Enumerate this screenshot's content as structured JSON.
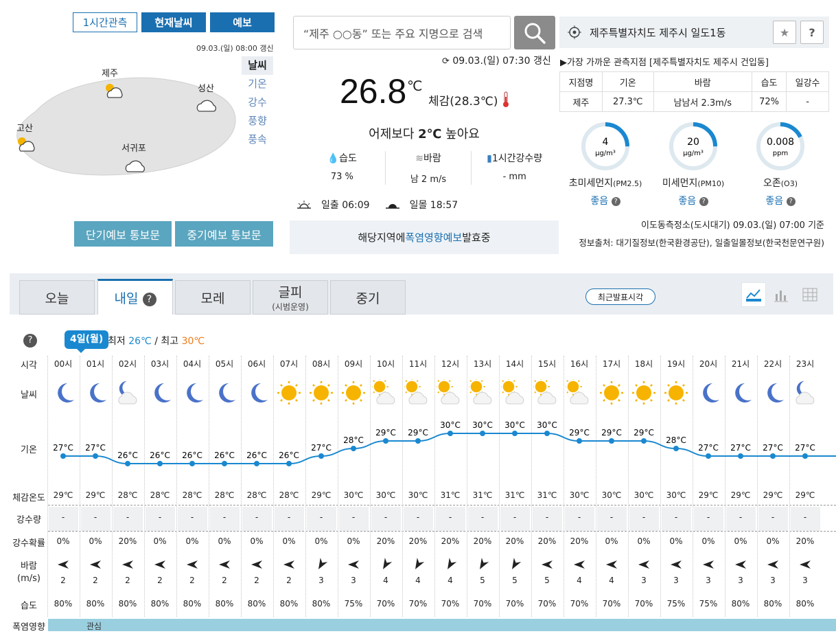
{
  "map": {
    "tabs": [
      "1시간관측",
      "현재날씨",
      "예보"
    ],
    "update_time": "09.03.(일) 08:00 갱신",
    "layers": [
      "날씨",
      "기온",
      "강수",
      "풍향",
      "풍속"
    ],
    "cities": {
      "jeju": "제주",
      "seongsan": "성산",
      "gosan": "고산",
      "seogwipo": "서귀포"
    },
    "buttons": {
      "short_term": "단기예보 통보문",
      "mid_term": "중기예보 통보문"
    }
  },
  "search": {
    "placeholder": "“제주 ○○동” 또는 주요 지명으로 검색"
  },
  "current": {
    "update_time": "09.03.(일) 07:30 갱신",
    "temp": "26.8",
    "unit": "℃",
    "feels": "체감(28.3℃)",
    "compare_pre": "어제보다 ",
    "compare_val": "2℃",
    "compare_post": " 높아요",
    "humidity_label": "습도",
    "humidity_value": "73 %",
    "wind_label": "바람",
    "wind_value": "남 2 m/s",
    "rain_label": "1시간강수량",
    "rain_value": "- mm",
    "sunrise_label": "일출",
    "sunrise": "06:09",
    "sunset_label": "일몰",
    "sunset": "18:57",
    "heat_notice_pre": "해당지역에 ",
    "heat_notice_link": "폭염영향예보",
    "heat_notice_post": " 발효중"
  },
  "location": {
    "name": "제주특별자치도 제주시 일도1동",
    "star_icon": "★",
    "help": "?",
    "nearest": "▶가장 가까운 관측지점 [제주특별자치도 제주시 건입동]",
    "table_headers": [
      "지점명",
      "기온",
      "바람",
      "습도",
      "일강수"
    ],
    "table_row": [
      "제주",
      "27.3℃",
      "남남서 2.3m/s",
      "72%",
      "-"
    ]
  },
  "air": {
    "items": [
      {
        "value": "4",
        "unit": "μg/m³",
        "label": "초미세먼지",
        "sub": "(PM2.5)",
        "grade": "좋음",
        "fraction": 0.25
      },
      {
        "value": "20",
        "unit": "μg/m³",
        "label": "미세먼지",
        "sub": "(PM10)",
        "grade": "좋음",
        "fraction": 0.25
      },
      {
        "value": "0.008",
        "unit": "ppm",
        "label": "오존",
        "sub": "(O3)",
        "grade": "좋음",
        "fraction": 0.18
      }
    ],
    "station": "이도동측정소(도시대기) 09.03.(일) 07:00 기준",
    "source": "정보출처: 대기질정보(한국환경공단), 일출일몰정보(한국천문연구원)"
  },
  "forecast": {
    "tabs": [
      {
        "label": "오늘",
        "sub": ""
      },
      {
        "label": "내일",
        "sub": ""
      },
      {
        "label": "모레",
        "sub": ""
      },
      {
        "label": "글피",
        "sub": "(시범운영)"
      },
      {
        "label": "중기",
        "sub": ""
      }
    ],
    "recent_button": "최근발표시각",
    "day_pill": "4일(월)",
    "min_label": "최저",
    "min_value": "26℃",
    "max_label": "최고",
    "max_value": "30℃",
    "row_labels": {
      "time": "시각",
      "weather": "날씨",
      "temp": "기온",
      "feels": "체감온도",
      "rain": "강수량",
      "rain_prob": "강수확률",
      "wind": "바람",
      "wind_unit": "(m/s)",
      "humidity": "습도",
      "heat": "폭염영향"
    },
    "heat_level": "관심",
    "hours": [
      "00시",
      "01시",
      "02시",
      "03시",
      "04시",
      "05시",
      "06시",
      "07시",
      "08시",
      "09시",
      "10시",
      "11시",
      "12시",
      "13시",
      "14시",
      "15시",
      "16시",
      "17시",
      "18시",
      "19시",
      "20시",
      "21시",
      "22시",
      "23시"
    ],
    "weather_icons": [
      "moon",
      "moon",
      "moon-cloud",
      "moon",
      "moon",
      "moon",
      "moon",
      "sun",
      "sun",
      "sun",
      "sun-cloud",
      "sun-cloud",
      "sun-cloud",
      "sun-cloud",
      "sun-cloud",
      "sun-cloud",
      "sun-cloud",
      "sun",
      "sun",
      "sun",
      "moon",
      "moon",
      "moon",
      "moon-cloud"
    ],
    "temps": [
      27,
      27,
      26,
      26,
      26,
      26,
      26,
      26,
      27,
      28,
      29,
      29,
      30,
      30,
      30,
      30,
      29,
      29,
      29,
      28,
      27,
      27,
      27,
      27
    ],
    "feels": [
      "29℃",
      "29℃",
      "28℃",
      "28℃",
      "28℃",
      "28℃",
      "28℃",
      "28℃",
      "29℃",
      "30℃",
      "30℃",
      "30℃",
      "31℃",
      "31℃",
      "31℃",
      "31℃",
      "30℃",
      "30℃",
      "30℃",
      "30℃",
      "29℃",
      "29℃",
      "29℃",
      "29℃"
    ],
    "rain": [
      "-",
      "-",
      "-",
      "-",
      "-",
      "-",
      "-",
      "-",
      "-",
      "-",
      "-",
      "-",
      "-",
      "-",
      "-",
      "-",
      "-",
      "-",
      "-",
      "-",
      "-",
      "-",
      "-",
      "-"
    ],
    "rain_prob": [
      "0%",
      "0%",
      "20%",
      "0%",
      "0%",
      "0%",
      "0%",
      "0%",
      "0%",
      "0%",
      "20%",
      "20%",
      "20%",
      "20%",
      "20%",
      "20%",
      "20%",
      "0%",
      "0%",
      "0%",
      "0%",
      "0%",
      "0%",
      "20%"
    ],
    "wind_dir_deg": [
      270,
      270,
      270,
      270,
      270,
      270,
      270,
      270,
      210,
      270,
      210,
      210,
      210,
      210,
      210,
      270,
      270,
      270,
      270,
      270,
      270,
      270,
      270,
      270
    ],
    "wind_speed": [
      "2",
      "2",
      "2",
      "2",
      "2",
      "2",
      "2",
      "2",
      "3",
      "3",
      "4",
      "4",
      "4",
      "5",
      "5",
      "5",
      "4",
      "4",
      "3",
      "3",
      "3",
      "3",
      "3",
      "3"
    ],
    "humidity": [
      "80%",
      "80%",
      "80%",
      "80%",
      "80%",
      "80%",
      "80%",
      "80%",
      "80%",
      "75%",
      "70%",
      "70%",
      "70%",
      "70%",
      "70%",
      "70%",
      "70%",
      "70%",
      "70%",
      "75%",
      "75%",
      "80%",
      "80%",
      "80%"
    ]
  }
}
